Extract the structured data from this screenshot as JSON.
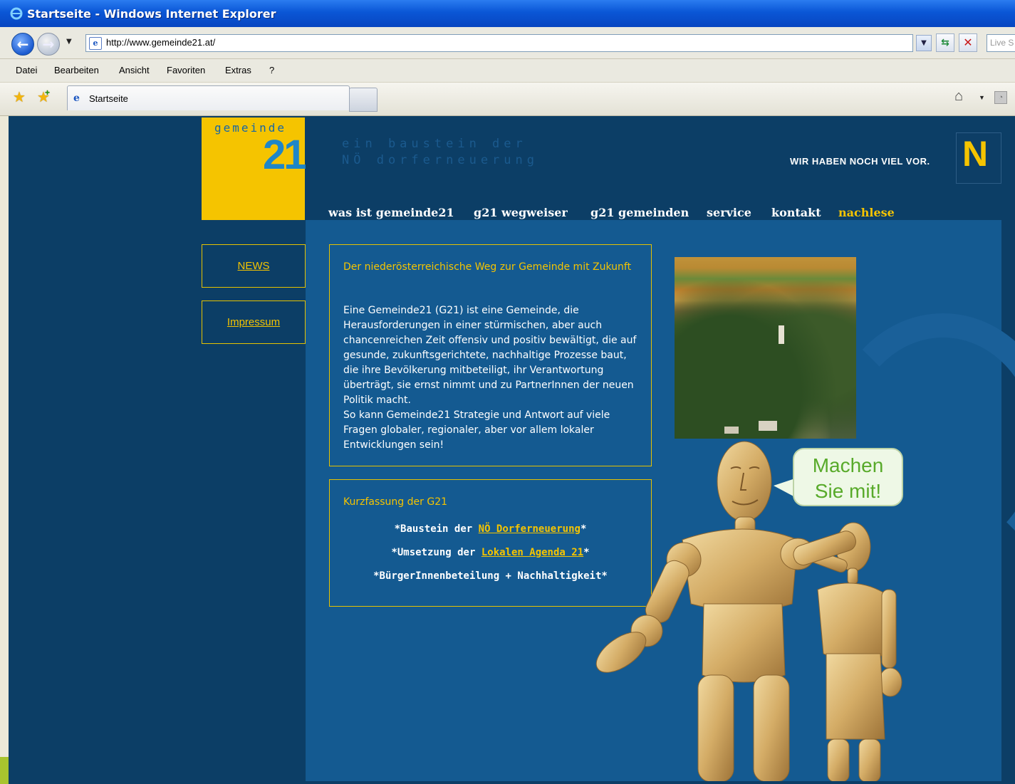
{
  "window": {
    "title": "Startseite - Windows Internet Explorer"
  },
  "toolbar": {
    "url": "http://www.gemeinde21.at/",
    "search_placeholder": "Live S"
  },
  "menu": [
    "Datei",
    "Bearbeiten",
    "Ansicht",
    "Favoriten",
    "Extras",
    "?"
  ],
  "tabs": [
    {
      "label": "Startseite"
    }
  ],
  "header": {
    "logo_word": "gemeinde",
    "logo_number": "21",
    "tagline_line1": "ein baustein der",
    "tagline_line2": "NÖ dorferneuerung",
    "slogan": "WIR HABEN NOCH VIEL VOR.",
    "noe_letter": "N"
  },
  "nav": [
    "was ist gemeinde21",
    "g21 wegweiser",
    "g21 gemeinden",
    "service",
    "kontakt",
    "nachlese"
  ],
  "sidebar": [
    "NEWS",
    "Impressum"
  ],
  "intro": {
    "title": "Der niederösterreichische Weg zur Gemeinde mit Zukunft",
    "body": "Eine Gemeinde21 (G21) ist eine Gemeinde, die Herausforderungen in einer stürmischen, aber auch chancenreichen Zeit offensiv und positiv bewältigt, die auf gesunde, zukunftsgerichtete, nachhaltige Prozesse baut, die ihre Bevölkerung mitbeteiligt, ihr Verantwortung überträgt, sie ernst nimmt und zu PartnerInnen der neuen Politik macht.",
    "body2": "So kann Gemeinde21 Strategie und Antwort auf viele Fragen globaler, regionaler, aber vor allem lokaler Entwicklungen sein!"
  },
  "summary": {
    "title": "Kurzfassung der G21",
    "line1_prefix": "*Baustein der ",
    "line1_link": "NÖ Dorferneuerung",
    "line1_suffix": "*",
    "line2_prefix": "*Umsetzung der ",
    "line2_link": "Lokalen Agenda 21",
    "line2_suffix": "*",
    "line3": "*BürgerInnenbeteilung + Nachhaltigkeit*"
  },
  "bubble": {
    "line1": "Machen",
    "line2": "Sie mit!"
  },
  "colors": {
    "accent": "#f5c400",
    "page_bg": "#0c3e66",
    "panel_bg": "#145a91",
    "link_active": "#f5c400"
  }
}
